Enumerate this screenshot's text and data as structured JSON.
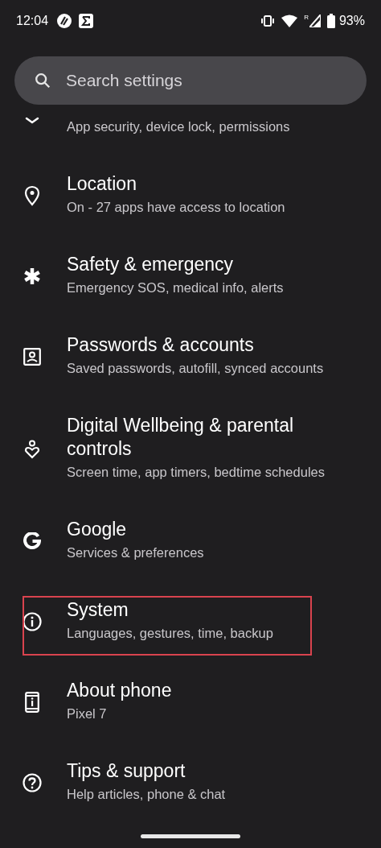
{
  "status_bar": {
    "time": "12:04",
    "battery": "93%",
    "roaming_mark": "R"
  },
  "search": {
    "placeholder": "Search settings"
  },
  "items": [
    {
      "kind": "partial",
      "subtitle": "App security, device lock, permissions",
      "highlighted": false
    },
    {
      "kind": "full",
      "title": "Location",
      "subtitle": "On - 27 apps have access to location",
      "highlighted": false
    },
    {
      "kind": "full",
      "title": "Safety & emergency",
      "subtitle": "Emergency SOS, medical info, alerts",
      "highlighted": false
    },
    {
      "kind": "full",
      "title": "Passwords & accounts",
      "subtitle": "Saved passwords, autofill, synced accounts",
      "highlighted": false
    },
    {
      "kind": "full",
      "title": "Digital Wellbeing & parental controls",
      "subtitle": "Screen time, app timers, bedtime schedules",
      "highlighted": false
    },
    {
      "kind": "full",
      "title": "Google",
      "subtitle": "Services & preferences",
      "highlighted": false
    },
    {
      "kind": "full",
      "title": "System",
      "subtitle": "Languages, gestures, time, backup",
      "highlighted": true
    },
    {
      "kind": "full",
      "title": "About phone",
      "subtitle": "Pixel 7",
      "highlighted": false
    },
    {
      "kind": "full",
      "title": "Tips & support",
      "subtitle": "Help articles, phone & chat",
      "highlighted": false
    }
  ]
}
